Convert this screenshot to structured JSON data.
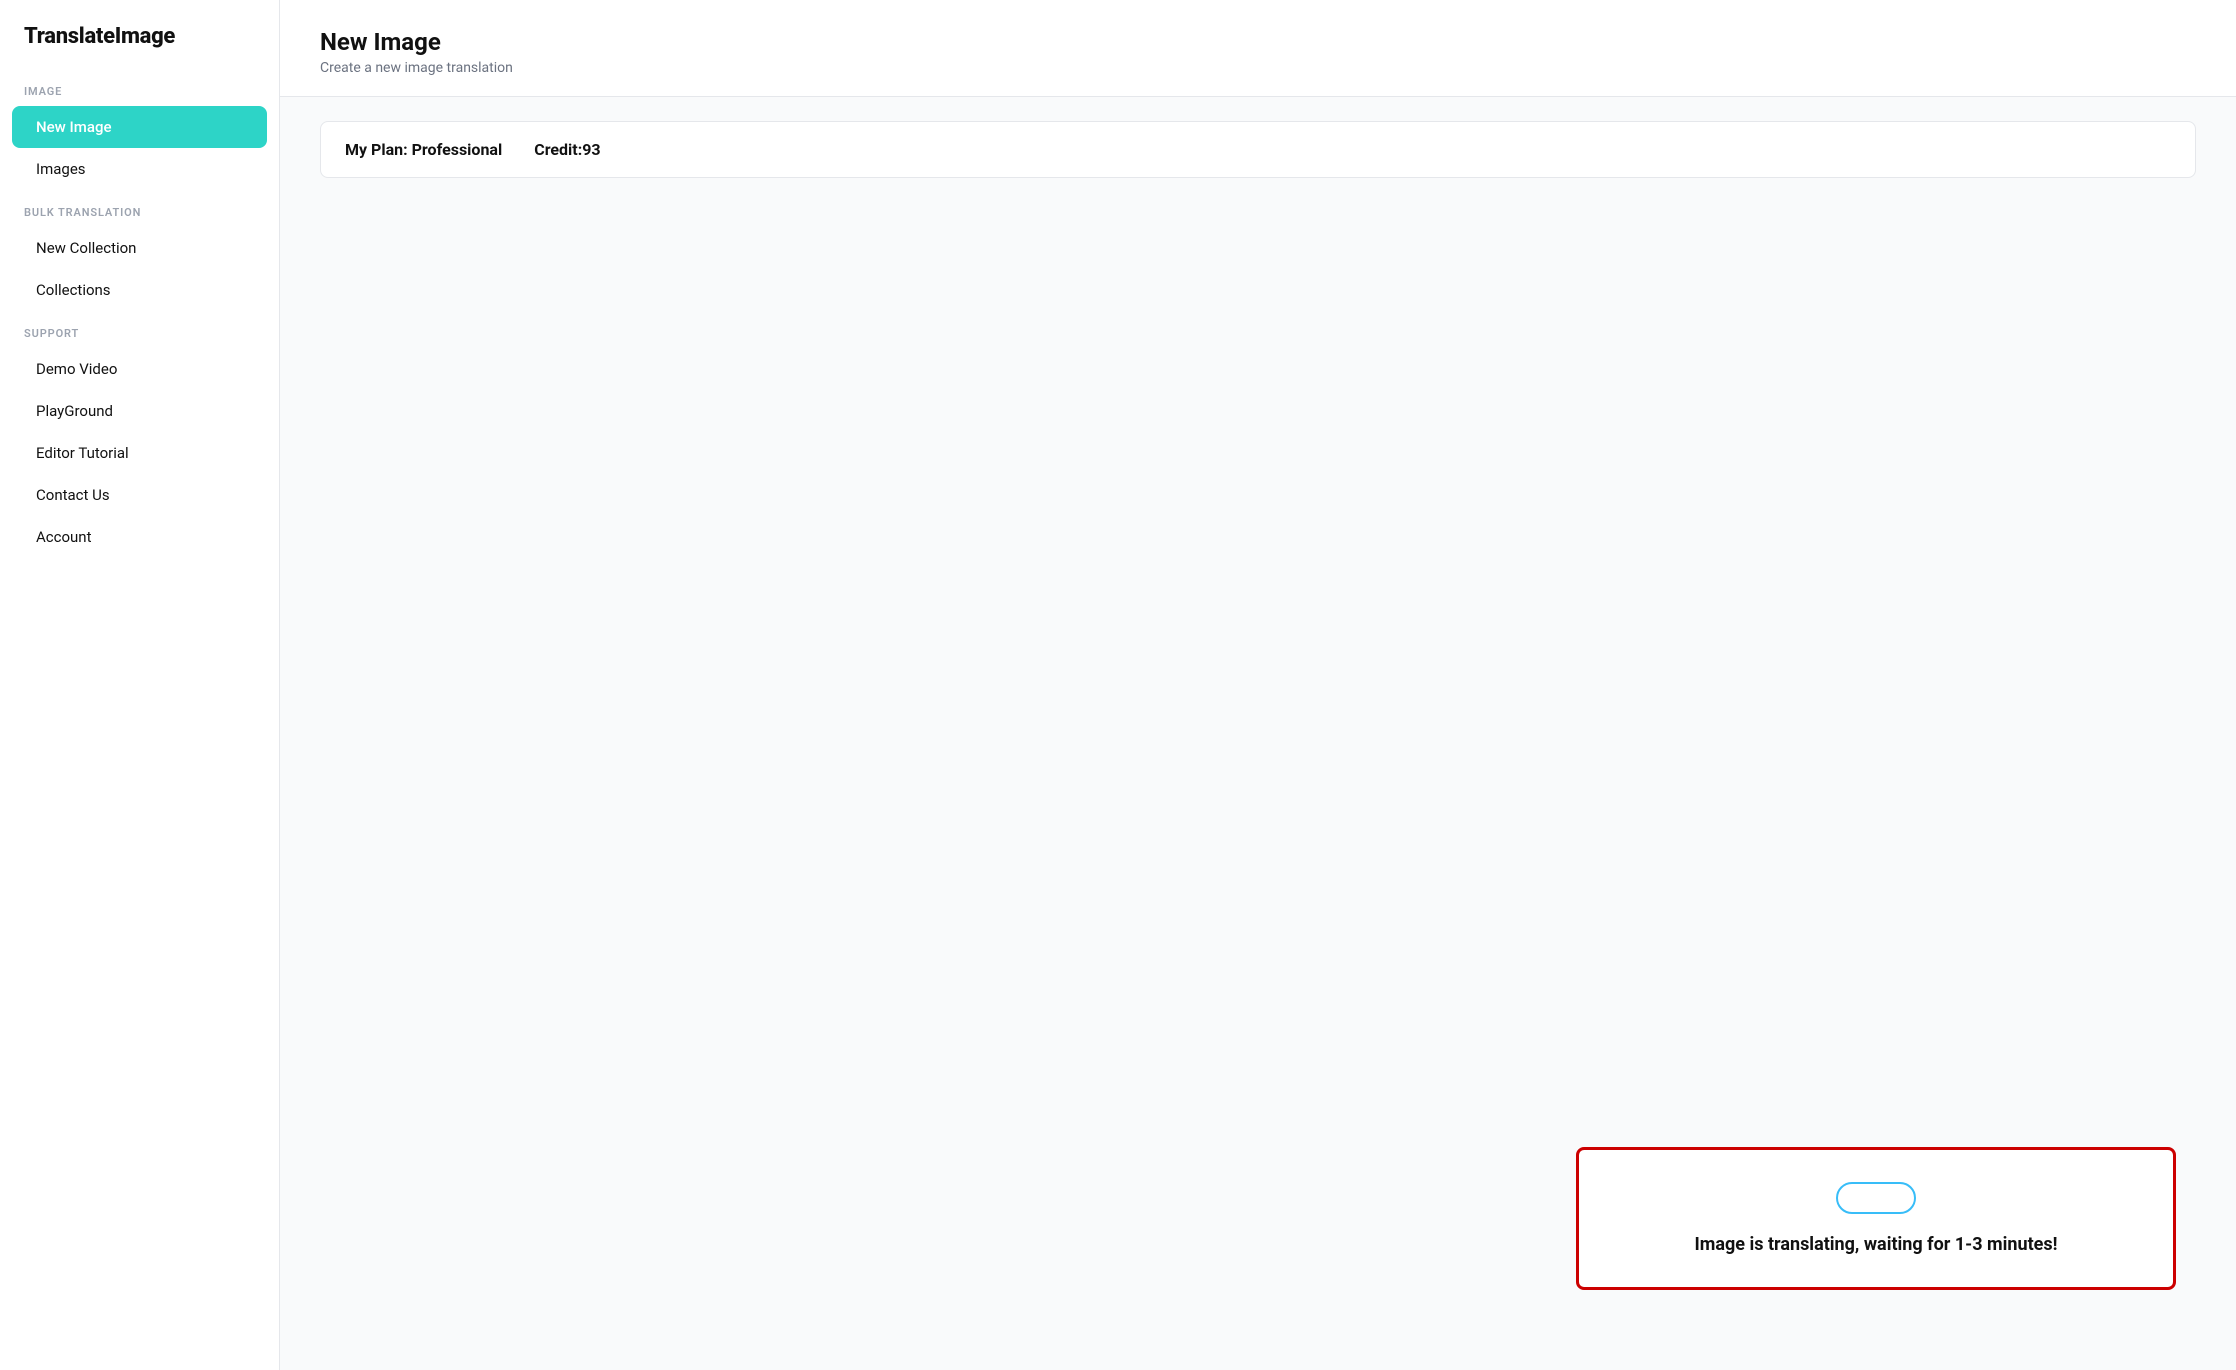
{
  "app": {
    "name": "TranslateImage"
  },
  "sidebar": {
    "logo": "TranslateImage",
    "sections": [
      {
        "label": "IMAGE",
        "items": [
          {
            "id": "new-image",
            "label": "New Image",
            "active": true
          },
          {
            "id": "images",
            "label": "Images",
            "active": false
          }
        ]
      },
      {
        "label": "BULK TRANSLATION",
        "items": [
          {
            "id": "new-collection",
            "label": "New Collection",
            "active": false
          },
          {
            "id": "collections",
            "label": "Collections",
            "active": false
          }
        ]
      },
      {
        "label": "SUPPORT",
        "items": [
          {
            "id": "demo-video",
            "label": "Demo Video",
            "active": false
          },
          {
            "id": "playground",
            "label": "PlayGround",
            "active": false
          },
          {
            "id": "editor-tutorial",
            "label": "Editor Tutorial",
            "active": false
          },
          {
            "id": "contact-us",
            "label": "Contact Us",
            "active": false
          },
          {
            "id": "account",
            "label": "Account",
            "active": false
          }
        ]
      }
    ]
  },
  "main": {
    "title": "New Image",
    "subtitle": "Create a new image translation",
    "plan": {
      "label": "My Plan: Professional",
      "credit_label": "Credit:93"
    },
    "status_box": {
      "message": "Image is translating, waiting for 1-3 minutes!"
    }
  }
}
